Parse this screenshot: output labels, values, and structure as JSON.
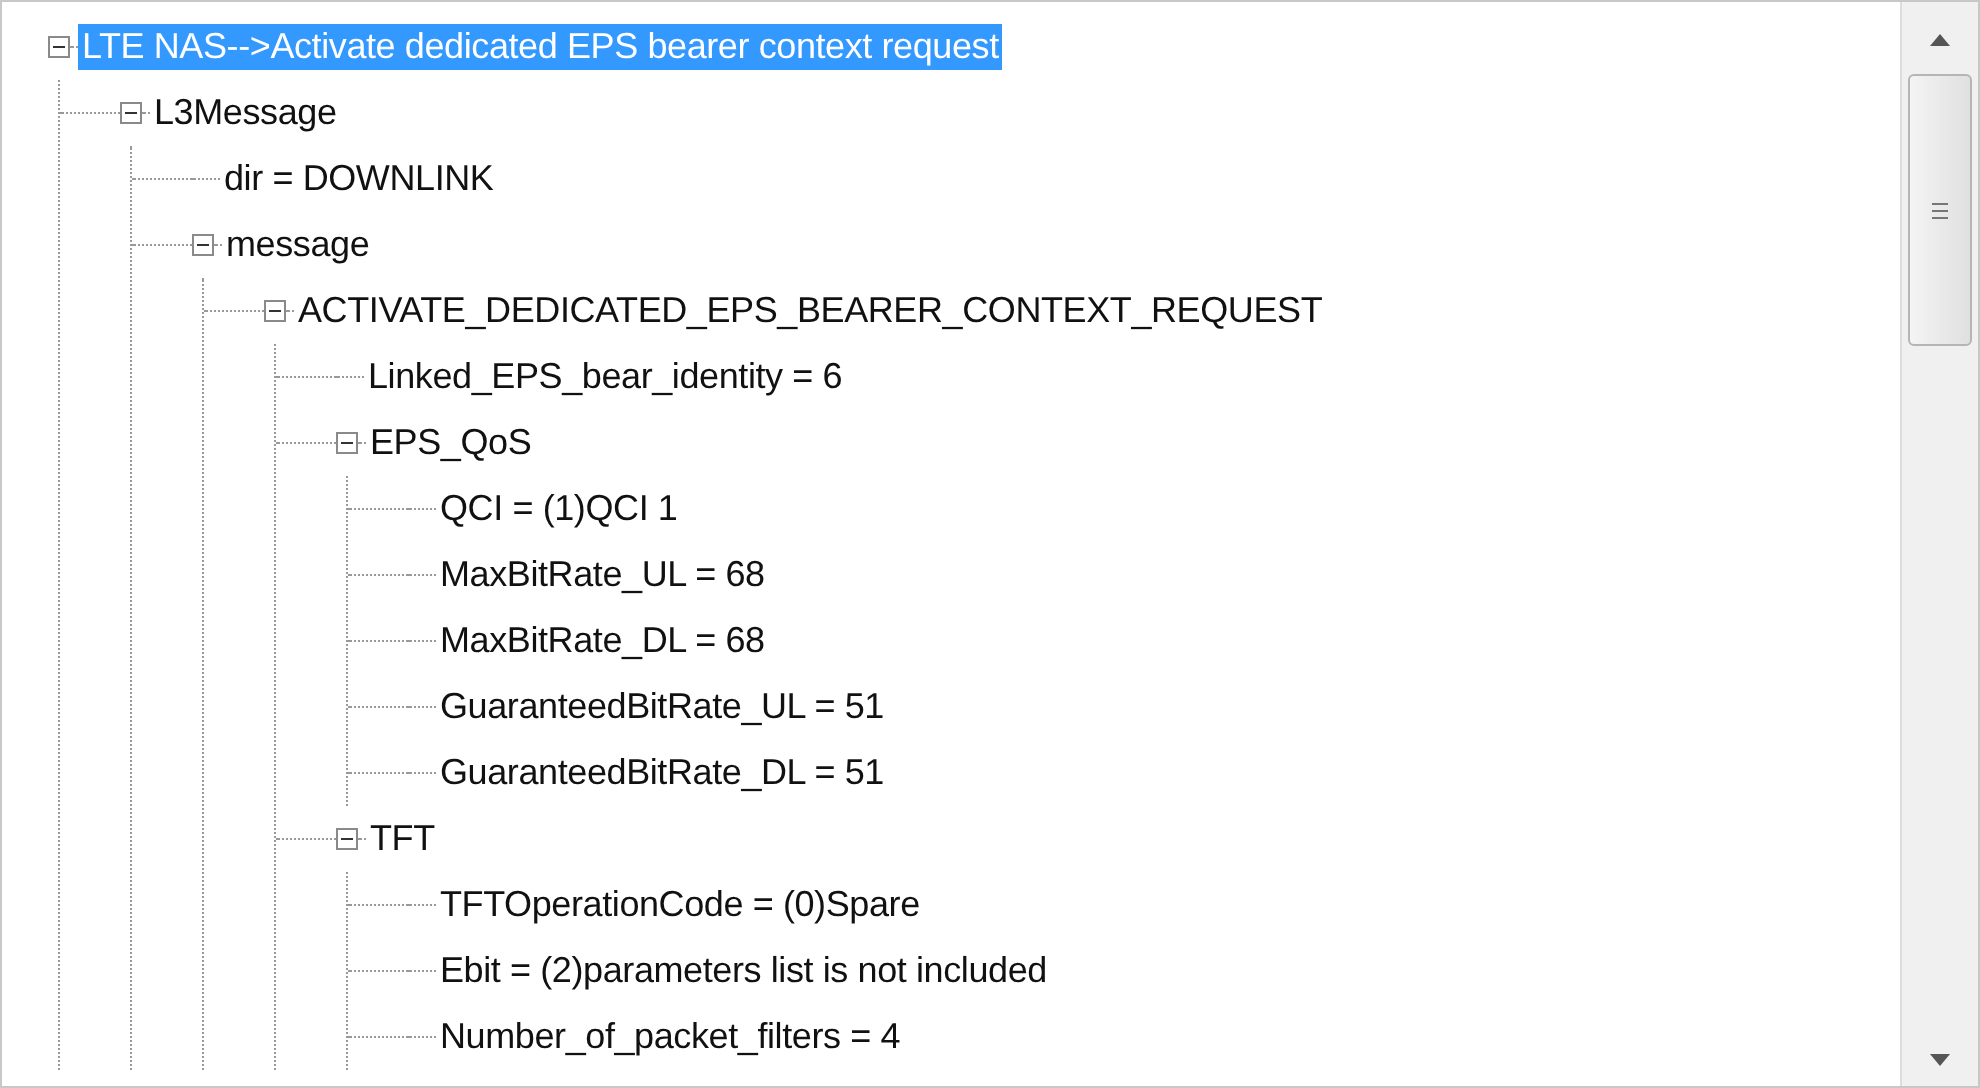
{
  "tree": [
    {
      "label": "LTE NAS-->Activate dedicated EPS bearer context request",
      "selected": true,
      "expanded": true,
      "children": [
        {
          "label": "L3Message",
          "selected": false,
          "expanded": true,
          "children": [
            {
              "label": "dir = DOWNLINK",
              "selected": false
            },
            {
              "label": "message",
              "selected": false,
              "expanded": true,
              "children": [
                {
                  "label": "ACTIVATE_DEDICATED_EPS_BEARER_CONTEXT_REQUEST",
                  "selected": false,
                  "expanded": true,
                  "children": [
                    {
                      "label": "Linked_EPS_bear_identity = 6",
                      "selected": false
                    },
                    {
                      "label": "EPS_QoS",
                      "selected": false,
                      "expanded": true,
                      "children": [
                        {
                          "label": "QCI = (1)QCI 1",
                          "selected": false
                        },
                        {
                          "label": "MaxBitRate_UL = 68",
                          "selected": false
                        },
                        {
                          "label": "MaxBitRate_DL = 68",
                          "selected": false
                        },
                        {
                          "label": "GuaranteedBitRate_UL = 51",
                          "selected": false
                        },
                        {
                          "label": "GuaranteedBitRate_DL = 51",
                          "selected": false
                        }
                      ]
                    },
                    {
                      "label": "TFT",
                      "selected": false,
                      "expanded": true,
                      "children": [
                        {
                          "label": "TFTOperationCode = (0)Spare",
                          "selected": false
                        },
                        {
                          "label": "Ebit = (2)parameters list is not included",
                          "selected": false
                        },
                        {
                          "label": "Number_of_packet_filters = 4",
                          "selected": false
                        }
                      ]
                    }
                  ]
                }
              ]
            }
          ]
        }
      ]
    }
  ]
}
